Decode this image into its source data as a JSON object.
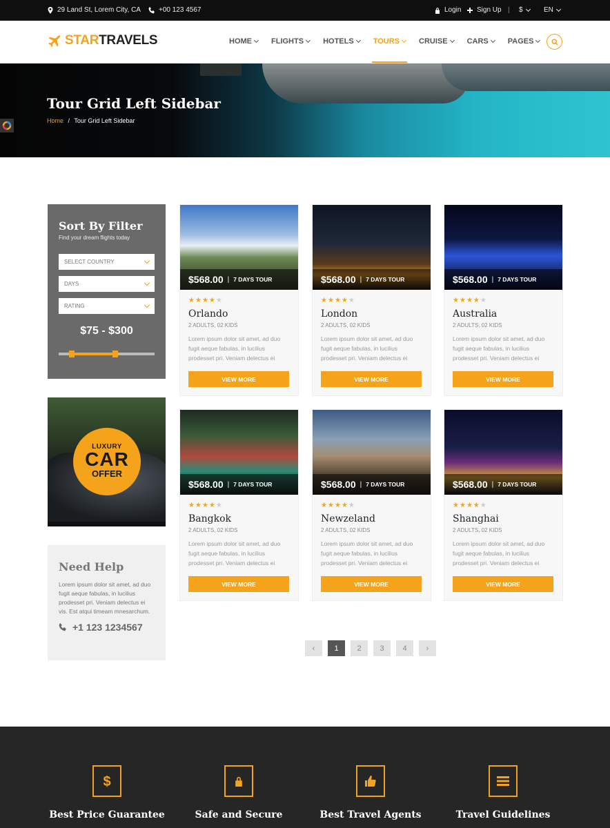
{
  "topbar": {
    "address": "29 Land St, Lorem City, CA",
    "phone": "+00 123 4567",
    "login": "Login",
    "signup": "Sign Up",
    "currency": "$",
    "language": "EN"
  },
  "header": {
    "logo_a": "STAR",
    "logo_b": "TRAVELS",
    "nav": [
      {
        "label": "HOME"
      },
      {
        "label": "FLIGHTS"
      },
      {
        "label": "HOTELS"
      },
      {
        "label": "TOURS"
      },
      {
        "label": "CRUISE"
      },
      {
        "label": "CARS"
      },
      {
        "label": "PAGES"
      }
    ],
    "active_nav": "TOURS"
  },
  "hero": {
    "title": "Tour Grid Left Sidebar",
    "breadcrumb_home": "Home",
    "breadcrumb_sep": "/",
    "breadcrumb_current": "Tour Grid Left Sidebar"
  },
  "filter": {
    "title": "Sort By Filter",
    "subtitle": "Find your dream flights today",
    "selects": [
      "SELECT COUNTRY",
      "DAYS",
      "RATING"
    ],
    "price_range": "$75 - $300"
  },
  "ad": {
    "line1": "LUXURY",
    "line2": "CAR",
    "line3": "OFFER"
  },
  "help": {
    "title": "Need Help",
    "text": "Lorem ipsum dolor sit amet, ad duo fugit aeque fabulas, in lucilius prodesset pri. Veniam delectus ei vis. Est atqui timeam mnesarchum.",
    "phone": "+1 123 1234567"
  },
  "tours": [
    {
      "price": "$568.00",
      "duration": "7 DAYS TOUR",
      "rating": 4,
      "city": "Orlando",
      "pax": "2 ADULTS, 02 KIDS",
      "desc": "Lorem ipsum dolor sit amet, ad duo fugit aeque fabulas, in lucilius prodesset pri. Veniam delectus ei",
      "button": "VIEW MORE"
    },
    {
      "price": "$568.00",
      "duration": "7 DAYS TOUR",
      "rating": 4,
      "city": "London",
      "pax": "2 ADULTS, 02 KIDS",
      "desc": "Lorem ipsum dolor sit amet, ad duo fugit aeque fabulas, in lucilius prodesset pri. Veniam delectus ei",
      "button": "VIEW MORE"
    },
    {
      "price": "$568.00",
      "duration": "7 DAYS TOUR",
      "rating": 4,
      "city": "Australia",
      "pax": "2 ADULTS, 02 KIDS",
      "desc": "Lorem ipsum dolor sit amet, ad duo fugit aeque fabulas, in lucilius prodesset pri. Veniam delectus ei",
      "button": "VIEW MORE"
    },
    {
      "price": "$568.00",
      "duration": "7 DAYS TOUR",
      "rating": 4,
      "city": "Bangkok",
      "pax": "2 ADULTS, 02 KIDS",
      "desc": "Lorem ipsum dolor sit amet, ad duo fugit aeque fabulas, in lucilius prodesset pri. Veniam delectus ei",
      "button": "VIEW MORE"
    },
    {
      "price": "$568.00",
      "duration": "7 DAYS TOUR",
      "rating": 4,
      "city": "Newzeland",
      "pax": "2 ADULTS, 02 KIDS",
      "desc": "Lorem ipsum dolor sit amet, ad duo fugit aeque fabulas, in lucilius prodesset pri. Veniam delectus ei",
      "button": "VIEW MORE"
    },
    {
      "price": "$568.00",
      "duration": "7 DAYS TOUR",
      "rating": 4,
      "city": "Shanghai",
      "pax": "2 ADULTS, 02 KIDS",
      "desc": "Lorem ipsum dolor sit amet, ad duo fugit aeque fabulas, in lucilius prodesset pri. Veniam delectus ei",
      "button": "VIEW MORE"
    }
  ],
  "pagination": {
    "prev": "‹",
    "pages": [
      "1",
      "2",
      "3",
      "4"
    ],
    "current": "1",
    "next": "›"
  },
  "features": [
    {
      "title": "Best Price Guarantee",
      "icon": "dollar-icon"
    },
    {
      "title": "Safe and Secure",
      "icon": "lock-icon"
    },
    {
      "title": "Best Travel Agents",
      "icon": "thumbs-up-icon"
    },
    {
      "title": "Travel Guidelines",
      "icon": "list-icon"
    }
  ],
  "colors": {
    "accent": "#f5a31a",
    "topbar": "#0f0f0f",
    "footer": "#262626"
  }
}
